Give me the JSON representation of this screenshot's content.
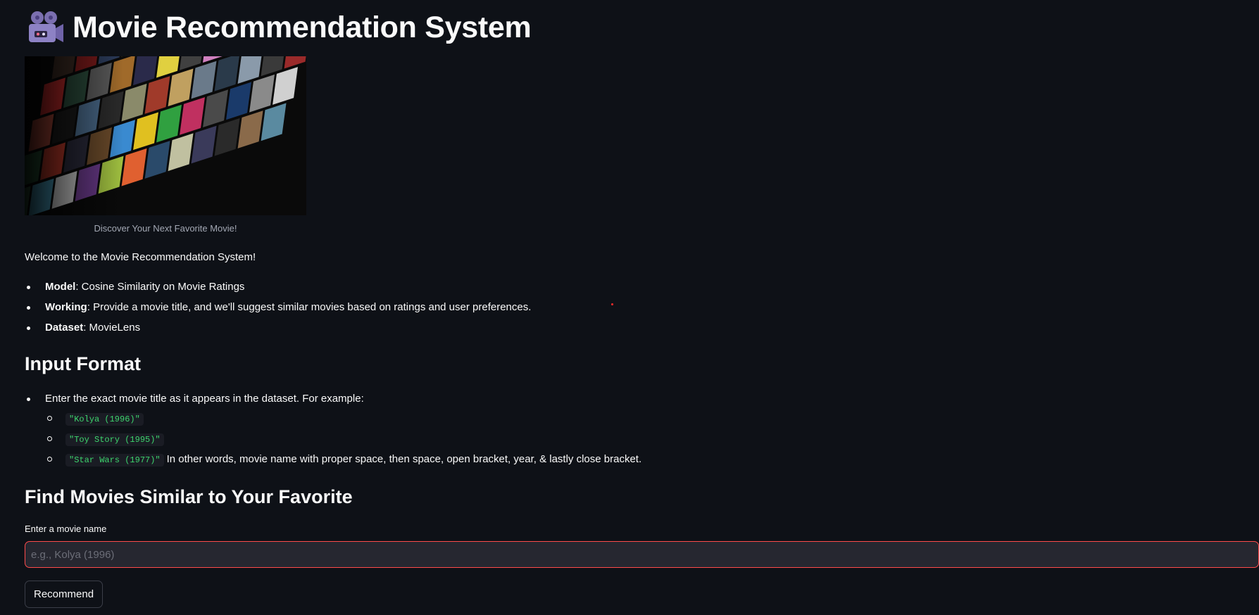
{
  "header": {
    "icon": "movie-camera-icon",
    "title": "Movie Recommendation System"
  },
  "hero": {
    "caption": "Discover Your Next Favorite Movie!"
  },
  "intro": {
    "welcome": "Welcome to the Movie Recommendation System!",
    "items": [
      {
        "label": "Model",
        "text": ": Cosine Similarity on Movie Ratings"
      },
      {
        "label": "Working",
        "text": ": Provide a movie title, and we'll suggest similar movies based on ratings and user preferences."
      },
      {
        "label": "Dataset",
        "text": ": MovieLens"
      }
    ]
  },
  "input_format": {
    "heading": "Input Format",
    "instruction": "Enter the exact movie title as it appears in the dataset. For example:",
    "examples": [
      {
        "code": "\"Kolya (1996)\"",
        "note": ""
      },
      {
        "code": "\"Toy Story (1995)\"",
        "note": ""
      },
      {
        "code": "\"Star Wars (1977)\"",
        "note": "In other words, movie name with proper space, then space, open bracket, year, & lastly close bracket."
      }
    ]
  },
  "search": {
    "heading": "Find Movies Similar to Your Favorite",
    "label": "Enter a movie name",
    "placeholder": "e.g., Kolya (1996)",
    "value": "",
    "button_label": "Recommend"
  },
  "colors": {
    "background": "#0e1117",
    "input_border_focus": "#ff4b4b",
    "code_text": "#3dd56d",
    "input_bg": "#262730"
  }
}
